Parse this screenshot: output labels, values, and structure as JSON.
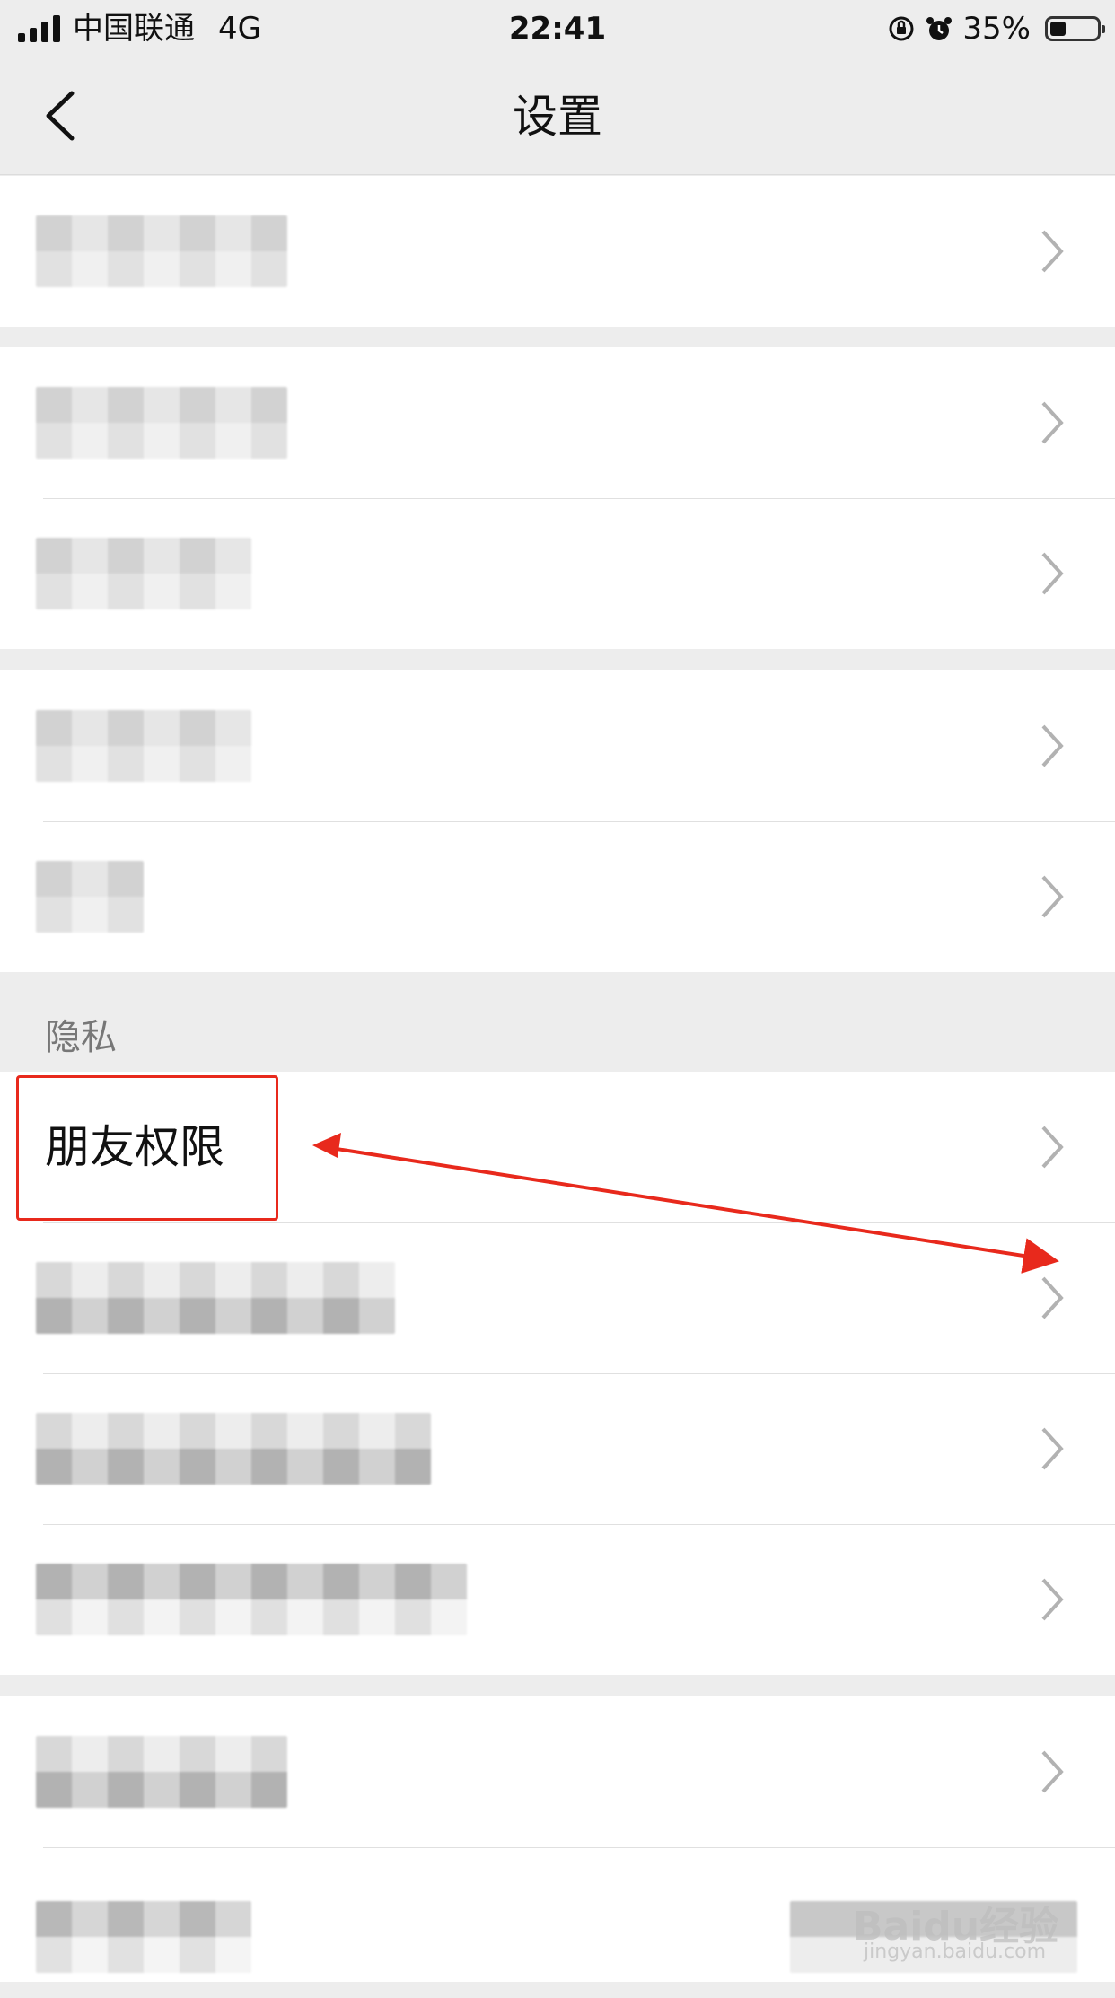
{
  "status_bar": {
    "carrier": "中国联通",
    "network": "4G",
    "time": "22:41",
    "battery": "35%",
    "battery_level": 0.35
  },
  "nav": {
    "back_icon": "chevron-left-icon",
    "title": "设置"
  },
  "section": {
    "privacy_header": "隐私",
    "friend_permissions_label": "朋友权限"
  },
  "watermark": {
    "brand": "Baidu经验",
    "url": "jingyan.baidu.com"
  },
  "colors": {
    "background": "#ededed",
    "cell": "#ffffff",
    "highlight": "#e8291c",
    "chevron": "#b2b2b2"
  }
}
